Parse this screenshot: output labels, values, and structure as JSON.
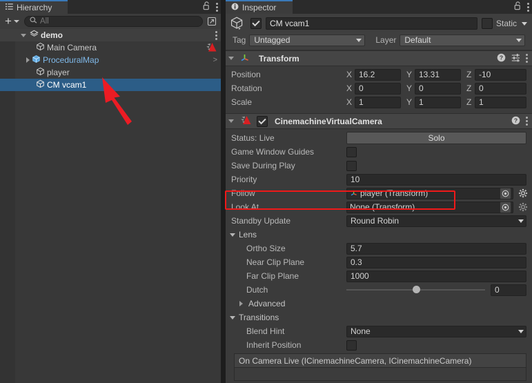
{
  "hierarchy": {
    "tab_label": "Hierarchy",
    "tab_icon": "hierarchy-icon",
    "lock_icon": "lock-open-icon",
    "menu_icon": "kebab-menu-icon",
    "toolbar": {
      "add_label": "+",
      "search_placeholder": "All",
      "search_value": "",
      "search_icon": "search-icon",
      "expand_icon": "open-in-new-icon"
    },
    "items": [
      {
        "label": "demo",
        "icon": "scene-icon",
        "indent": 0,
        "foldout": "open",
        "selected": false,
        "scene": true,
        "menu": true
      },
      {
        "label": "Main Camera",
        "icon": "gameobject-cube-icon",
        "indent": 1,
        "foldout": "none",
        "selected": false,
        "badge": "cinemachine-brain-icon"
      },
      {
        "label": "ProceduralMap",
        "icon": "prefab-cube-icon",
        "indent": 1,
        "foldout": "closed",
        "selected": false,
        "prefab": true,
        "chevron": ">"
      },
      {
        "label": "player",
        "icon": "gameobject-cube-icon",
        "indent": 1,
        "foldout": "none",
        "selected": false
      },
      {
        "label": "CM vcam1",
        "icon": "gameobject-cube-icon",
        "indent": 1,
        "foldout": "none",
        "selected": true
      }
    ]
  },
  "inspector": {
    "tab_label": "Inspector",
    "tab_icon": "info-icon",
    "lock_icon": "lock-open-icon",
    "menu_icon": "kebab-menu-icon",
    "gameobject": {
      "icon": "gameobject-cube-icon",
      "enabled": true,
      "name": "CM vcam1",
      "static_label": "Static",
      "static_checked": false,
      "tag_label": "Tag",
      "tag_value": "Untagged",
      "layer_label": "Layer",
      "layer_value": "Default"
    },
    "components": [
      {
        "name": "transform-component",
        "title": "Transform",
        "icon": "transform-axis-icon",
        "expanded": true,
        "has_checkbox": false,
        "help_icon": "help-icon",
        "preset_icon": "preset-sliders-icon",
        "menu_icon": "kebab-menu-icon",
        "rows": [
          {
            "label": "Position",
            "x": "16.2",
            "y": "13.31",
            "z": "-10"
          },
          {
            "label": "Rotation",
            "x": "0",
            "y": "0",
            "z": "0"
          },
          {
            "label": "Scale",
            "x": "1",
            "y": "1",
            "z": "1"
          }
        ],
        "axis_labels": [
          "X",
          "Y",
          "Z"
        ]
      },
      {
        "name": "cinemachine-virtual-camera-component",
        "title": "CinemachineVirtualCamera",
        "icon": "cinemachine-icon",
        "expanded": true,
        "has_checkbox": true,
        "enabled": true,
        "help_icon": "help-icon",
        "menu_icon": "kebab-menu-icon"
      }
    ],
    "vcam": {
      "status_label": "Status: Live",
      "solo_label": "Solo",
      "game_window_guides_label": "Game Window Guides",
      "game_window_guides_checked": false,
      "save_during_play_label": "Save During Play",
      "save_during_play_checked": false,
      "priority_label": "Priority",
      "priority_value": "10",
      "follow_label": "Follow",
      "follow_value": "player (Transform)",
      "follow_icon": "transform-axis-icon",
      "look_at_label": "Look At",
      "look_at_value": "None (Transform)",
      "standby_update_label": "Standby Update",
      "standby_update_value": "Round Robin",
      "lens_label": "Lens",
      "lens_expanded": true,
      "ortho_size_label": "Ortho Size",
      "ortho_size_value": "5.7",
      "near_clip_label": "Near Clip Plane",
      "near_clip_value": "0.3",
      "far_clip_label": "Far Clip Plane",
      "far_clip_value": "1000",
      "dutch_label": "Dutch",
      "dutch_value": "0",
      "dutch_percent": 50,
      "advanced_label": "Advanced",
      "advanced_expanded": false,
      "transitions_label": "Transitions",
      "transitions_expanded": true,
      "blend_hint_label": "Blend Hint",
      "blend_hint_value": "None",
      "inherit_position_label": "Inherit Position",
      "inherit_position_checked": false,
      "event_title": "On Camera Live (ICinemachineCamera, ICinemachineCamera)"
    }
  },
  "annotations": {
    "highlight_color": "#f01919",
    "arrow_color": "#ec1c24",
    "highlighted_field": "Follow",
    "arrow_points_to": "CM vcam1"
  },
  "theme": {
    "bg": "#383838",
    "panel_bg": "#3b3b3b",
    "tabbar_bg": "#2b2b2b",
    "selection_blue": "#2c5d87",
    "tab_accent": "#3a79b8",
    "field_bg": "#2a2a2a",
    "text": "#c4c4c4"
  }
}
